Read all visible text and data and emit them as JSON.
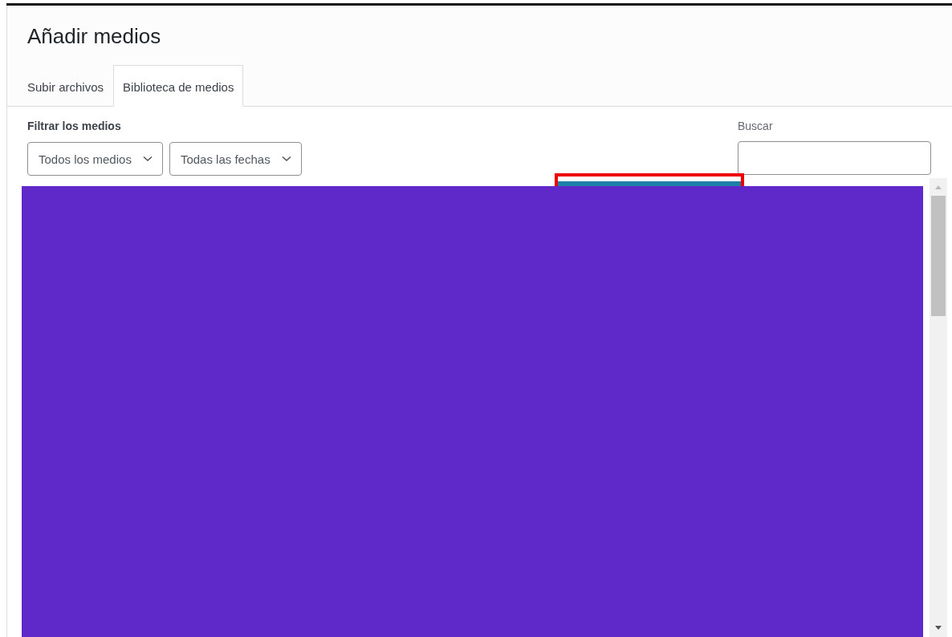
{
  "modal": {
    "title": "Añadir medios"
  },
  "tabs": [
    {
      "label": "Subir archivos",
      "selected": false
    },
    {
      "label": "Biblioteca de medios",
      "selected": true
    }
  ],
  "filters": {
    "label": "Filtrar los medios",
    "dropdowns": [
      "Todos los medios",
      "Todas las fechas"
    ]
  },
  "search": {
    "label": "Buscar"
  }
}
